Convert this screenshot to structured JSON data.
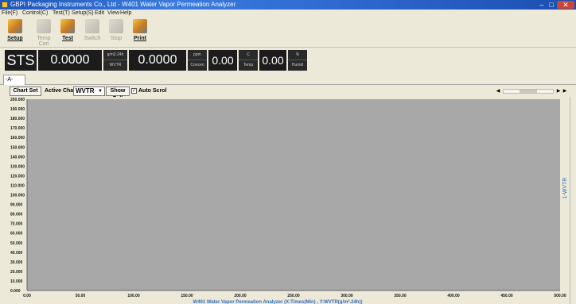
{
  "window": {
    "title": "GBPI Packaging Instruments Co., Ltd - W401 Water Vapor Permeation Analyzer"
  },
  "menu": [
    "File(F)",
    "Control(C)",
    "Test(T)",
    "Setup(S)",
    "Edit",
    "View",
    "Help"
  ],
  "toolbar": [
    {
      "label": "Setup",
      "icon": "setup-icon",
      "enabled": true
    },
    {
      "label": "Temp Con",
      "icon": "temp-con-icon",
      "enabled": false
    },
    {
      "label": "Test",
      "icon": "test-icon",
      "enabled": true
    },
    {
      "label": "Switch",
      "icon": "switch-icon",
      "enabled": false
    },
    {
      "label": "Stop",
      "icon": "stop-icon",
      "enabled": false
    },
    {
      "label": "Print",
      "icon": "print-icon",
      "enabled": true
    }
  ],
  "readouts": {
    "status": "STS",
    "wvtr_value": "0.0000",
    "wvtr_unit_top": "g/m2.24h",
    "wvtr_unit_bottom": "WVTR",
    "concen_value": "0.0000",
    "concen_unit_top": "ppm",
    "concen_unit_bottom": "Concen",
    "temp_value": "0.00",
    "temp_unit_top": "C",
    "temp_unit_bottom": "Temp",
    "humid_value": "0.00",
    "humid_unit_top": "%",
    "humid_unit_bottom": "Humid"
  },
  "tabs": [
    "-A-"
  ],
  "chart_controls": {
    "chart_set_label": "Chart Set",
    "active_chart_label": "Active Chart",
    "active_chart_value": "WVTR",
    "show_full_label": "Show Full",
    "auto_scroll_label": "Auto Scrol",
    "auto_scroll_checked": true
  },
  "colors": {
    "plot_background": "#a8a8a8",
    "axis_text": "#1a1a1a",
    "series_label": "#3b6fb8",
    "readout_background": "#1c1c1c"
  },
  "chart_data": {
    "type": "line",
    "title": "",
    "xlabel": "W401 Water Vapor Permeation Analyzer (X:Times(Min) , Y:WVTR(g/m².24h))",
    "ylabel": "",
    "xlim": [
      0,
      500
    ],
    "ylim": [
      0,
      200
    ],
    "x_ticks": [
      "0.00",
      "50.00",
      "100.00",
      "150.00",
      "200.00",
      "250.00",
      "300.00",
      "350.00",
      "400.00",
      "450.00",
      "500.00"
    ],
    "y_ticks": [
      "0.000",
      "10.000",
      "20.000",
      "30.000",
      "40.000",
      "50.000",
      "60.000",
      "70.000",
      "80.000",
      "90.000",
      "100.000",
      "110.000",
      "120.000",
      "130.000",
      "140.000",
      "150.000",
      "160.000",
      "170.000",
      "180.000",
      "190.000",
      "200.000"
    ],
    "series": [
      {
        "name": "1-WVTR",
        "x": [],
        "y": []
      }
    ],
    "grid": false
  }
}
